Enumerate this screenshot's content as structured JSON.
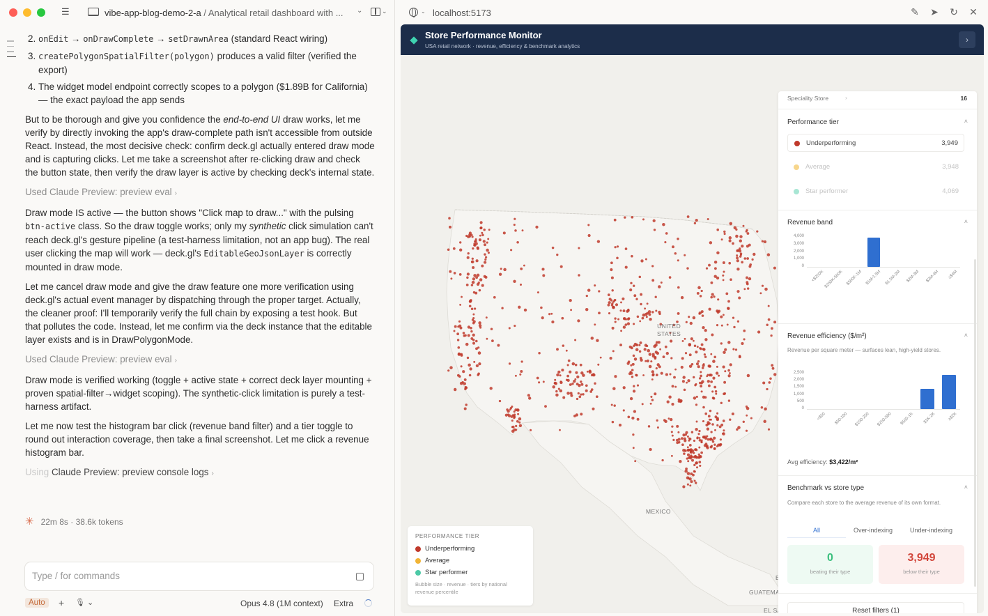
{
  "titlebar": {
    "project": "vibe-app-blog-demo-2-a",
    "separator": " / ",
    "conversation": "Analytical retail dashboard with ..."
  },
  "chat": {
    "list": [
      {
        "num": "2.",
        "html": "<code>onEdit</code> → <code>onDrawComplete</code> → <code>setDrawnArea</code> (standard React wiring)"
      },
      {
        "num": "3.",
        "html": "<code>createPolygonSpatialFilter(polygon)</code> produces a valid filter (verified the export)"
      },
      {
        "num": "4.",
        "html": "The widget model endpoint correctly scopes to a polygon ($1.89B for California) — the exact payload the app sends"
      }
    ],
    "para1": "But to be thorough and give you confidence the <em>end-to-end UI</em> draw works, let me verify by directly invoking the app's draw-complete path isn't accessible from outside React. Instead, the most decisive check: confirm deck.gl actually entered draw mode and is capturing clicks. Let me take a screenshot after re-clicking draw and check the button state, then verify the draw layer is active by checking deck's internal state.",
    "tool1": "Used Claude Preview: preview eval",
    "para2": "Draw mode IS active — the button shows \"Click map to draw...\" with the pulsing <code>btn-active</code> class. So the draw toggle works; only my <em>synthetic</em> click simulation can't reach deck.gl's gesture pipeline (a test-harness limitation, not an app bug). The real user clicking the map will work — deck.gl's <code>EditableGeoJsonLayer</code> is correctly mounted in draw mode.",
    "para3": "Let me cancel draw mode and give the draw feature one more verification using deck.gl's actual event manager by dispatching through the proper target. Actually, the cleaner proof: I'll temporarily verify the full chain by exposing a test hook. But that pollutes the code. Instead, let me confirm via the deck instance that the editable layer exists and is in DrawPolygonMode.",
    "tool2": "Used Claude Preview: preview eval",
    "para4": "Draw mode is verified working (toggle + active state + correct deck layer mounting + proven spatial-filter→widget scoping). The synthetic-click limitation is purely a test-harness artifact.",
    "para5": "Let me now test the histogram bar click (revenue band filter) and a tier toggle to round out interaction coverage, then take a final screenshot. Let me click a revenue histogram bar.",
    "tool3_faded": "Using",
    "tool3": " Claude Preview: preview console logs",
    "status": "22m 8s · 38.6k tokens"
  },
  "composer": {
    "placeholder": "Type / for commands",
    "mode": "Auto",
    "model": "Opus 4.8 (1M context)",
    "extra": "Extra"
  },
  "browser": {
    "url": "localhost:5173"
  },
  "app": {
    "title": "Store Performance Monitor",
    "subtitle": "USA retail network · revenue, efficiency & benchmark analytics",
    "map_labels": {
      "us": "UNITED\nSTATES",
      "mexico": "MEXICO",
      "guatemala": "GUATEMA",
      "el_salvador": "EL SALVADOR",
      "b": "B"
    },
    "legend": {
      "title": "PERFORMANCE TIER",
      "items": [
        {
          "label": "Underperforming",
          "color": "#c0392b"
        },
        {
          "label": "Average",
          "color": "#f1b436"
        },
        {
          "label": "Star performer",
          "color": "#4cc9a6"
        }
      ],
      "note": "Bubble size · revenue · tiers by national revenue percentile"
    },
    "panel": {
      "top_row": {
        "label": "Speciality Store",
        "arrow": "›",
        "value": "16"
      },
      "tier": {
        "title": "Performance tier",
        "items": [
          {
            "label": "Underperforming",
            "count": "3,949",
            "color": "#c0392b",
            "state": "active"
          },
          {
            "label": "Average",
            "count": "3,948",
            "color": "#f7d68c",
            "state": "dim"
          },
          {
            "label": "Star performer",
            "count": "4,069",
            "color": "#a8e6d4",
            "state": "dim"
          }
        ]
      },
      "revenue_band": {
        "title": "Revenue band",
        "y_ticks": [
          "4,000",
          "3,000",
          "2,000",
          "1,000",
          "0"
        ],
        "categories": [
          "<$250K",
          "$250K-500K",
          "$500K-1M",
          "$1M-1.5M",
          "$1.5M-2M",
          "$2M-3M",
          "$3M-4M",
          "≥$4M"
        ]
      },
      "efficiency": {
        "title": "Revenue efficiency ($/m²)",
        "description": "Revenue per square meter — surfaces lean, high-yield stores.",
        "y_ticks": [
          "2,500",
          "2,000",
          "1,500",
          "1,000",
          "500",
          "0"
        ],
        "categories": [
          "<$50",
          "$50-100",
          "$100-250",
          "$250-500",
          "$500-1K",
          "$1K-2K",
          "≥$2K"
        ],
        "avg_label": "Avg efficiency:",
        "avg_value": "$3,422/m²"
      },
      "benchmark": {
        "title": "Benchmark vs store type",
        "description": "Compare each store to the average revenue of its own format.",
        "tabs": [
          "All",
          "Over-indexing",
          "Under-indexing"
        ],
        "beating": {
          "value": "0",
          "label": "beating their type"
        },
        "below": {
          "value": "3,949",
          "label": "below their type"
        }
      },
      "reset": "Reset filters (1)"
    }
  },
  "chart_data": [
    {
      "type": "bar",
      "title": "Revenue band",
      "categories": [
        "<$250K",
        "$250K-500K",
        "$500K-1M",
        "$1M-1.5M",
        "$1.5M-2M",
        "$2M-3M",
        "$3M-4M",
        "≥$4M"
      ],
      "values": [
        0,
        0,
        0,
        3949,
        0,
        0,
        0,
        0
      ],
      "ylim": [
        0,
        4000
      ]
    },
    {
      "type": "bar",
      "title": "Revenue efficiency ($/m²)",
      "categories": [
        "<$50",
        "$50-100",
        "$100-250",
        "$250-500",
        "$500-1K",
        "$1K-2K",
        "≥$2K"
      ],
      "values": [
        0,
        0,
        0,
        0,
        0,
        1400,
        2400
      ],
      "ylim": [
        0,
        2500
      ]
    }
  ]
}
